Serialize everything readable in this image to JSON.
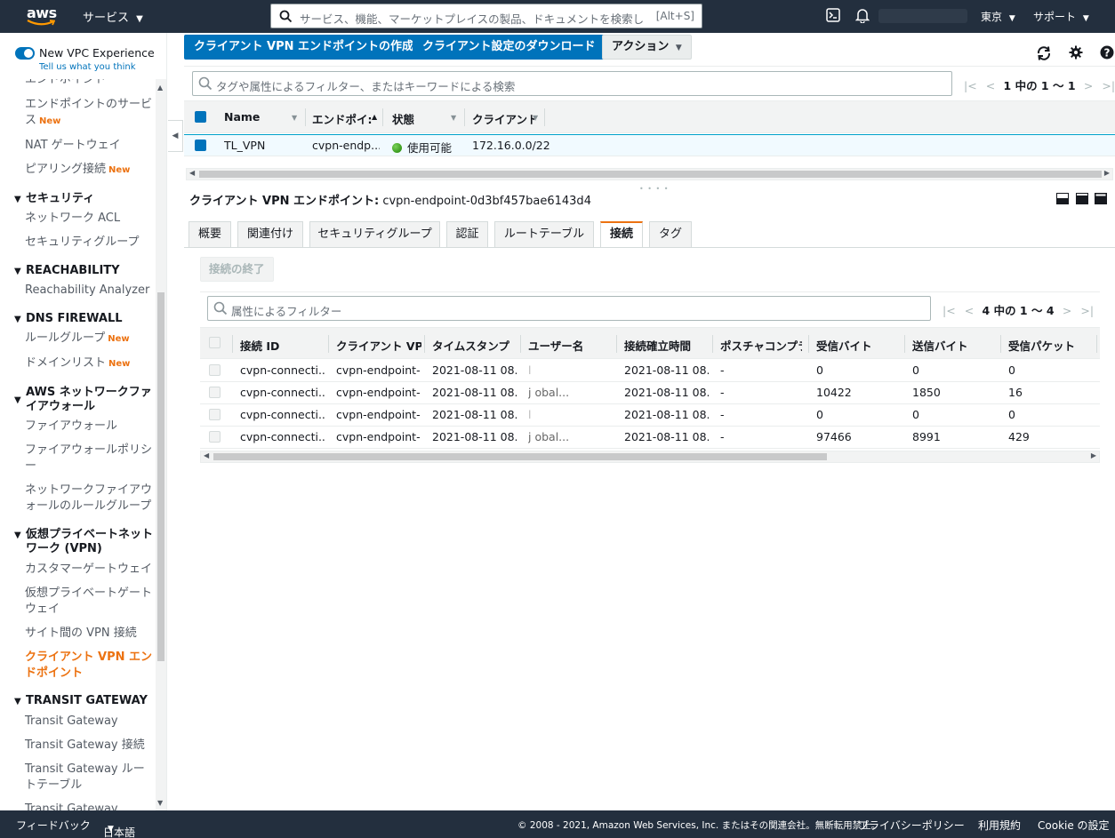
{
  "topnav": {
    "logo": "aws",
    "services_label": "サービス",
    "search_placeholder": "サービス、機能、マーケットプレイスの製品、ドキュメントを検索し",
    "search_shortcut": "[Alt+S]",
    "region_label": "東京",
    "support_label": "サポート"
  },
  "sidebar": {
    "vpc_experience_label": "New VPC Experience",
    "feedback_link": "Tell us what you think",
    "new_badge": "New",
    "items": {
      "endpoints": "エンドポイント",
      "endpoint_services": "エンドポイントのサービス",
      "nat_gateway": "NAT ゲートウェイ",
      "peering": "ピアリング接続",
      "network_acl": "ネットワーク ACL",
      "security_groups": "セキュリティグループ",
      "reachability_analyzer": "Reachability Analyzer",
      "rule_groups": "ルールグループ",
      "domain_lists": "ドメインリスト",
      "firewalls": "ファイアウォール",
      "firewall_policies": "ファイアウォールポリシー",
      "network_firewall_rule_groups": "ネットワークファイアウォールのルールグループ",
      "customer_gateways": "カスタマーゲートウェイ",
      "virtual_private_gateways": "仮想プライベートゲートウェイ",
      "site_to_site_vpn": "サイト間の VPN 接続",
      "client_vpn_endpoints": "クライアント VPN エンドポイント",
      "transit_gateways": "Transit Gateway",
      "transit_gateway_attachments": "Transit Gateway 接続",
      "transit_gateway_route_tables": "Transit Gateway ルートテーブル",
      "transit_gateway_more": "Transit Gateway"
    },
    "sections": {
      "security": "セキュリティ",
      "reachability": "REACHABILITY",
      "dns_firewall": "DNS FIREWALL",
      "network_firewall": "AWS ネットワークファイアウォール",
      "vpn": "仮想プライベートネットワーク (VPN)",
      "transit_gateway": "TRANSIT GATEWAY"
    }
  },
  "toolbar": {
    "create_button": "クライアント VPN エンドポイントの作成",
    "download_button": "クライアント設定のダウンロード",
    "actions_button": "アクション"
  },
  "endpoints_table": {
    "filter_placeholder": "タグや属性によるフィルター、またはキーワードによる検索",
    "pager_text": "1 中の 1 ～ 1",
    "columns": [
      "Name",
      "エンドポイ:",
      "状態",
      "クライアント"
    ],
    "rows": [
      {
        "name": "TL_VPN",
        "endpoint": "cvpn-endp...",
        "status": "使用可能",
        "client_cidr": "172.16.0.0/22"
      }
    ]
  },
  "detail": {
    "title_label": "クライアント VPN エンドポイント:",
    "endpoint_id": "cvpn-endpoint-0d3bf457bae6143d4",
    "tabs": [
      "概要",
      "関連付け",
      "セキュリティグループ",
      "認証",
      "ルートテーブル",
      "接続",
      "タグ"
    ],
    "active_tab": "接続",
    "terminate_button": "接続の終了"
  },
  "connections_table": {
    "filter_placeholder": "属性によるフィルター",
    "pager_text": "4 中の 1 ～ 4",
    "columns": [
      "接続 ID",
      "クライアント VP",
      "タイムスタンプ",
      "ユーザー名",
      "接続確立時間",
      "ポスチャコンプラ",
      "受信バイト",
      "送信バイト",
      "受信パケット"
    ],
    "rows": [
      {
        "id": "cvpn-connecti...",
        "endpoint": "cvpn-endpoint-...",
        "timestamp": "2021-08-11 08...",
        "username": "l",
        "established": "2021-08-11 08...",
        "posture": "-",
        "ingress_bytes": "0",
        "egress_bytes": "0",
        "ingress_packets": "0"
      },
      {
        "id": "cvpn-connecti...",
        "endpoint": "cvpn-endpoint-...",
        "timestamp": "2021-08-11 08...",
        "username": "j          obal...",
        "established": "2021-08-11 08...",
        "posture": "-",
        "ingress_bytes": "10422",
        "egress_bytes": "1850",
        "ingress_packets": "16"
      },
      {
        "id": "cvpn-connecti...",
        "endpoint": "cvpn-endpoint-...",
        "timestamp": "2021-08-11 08...",
        "username": "l",
        "established": "2021-08-11 08...",
        "posture": "-",
        "ingress_bytes": "0",
        "egress_bytes": "0",
        "ingress_packets": "0"
      },
      {
        "id": "cvpn-connecti...",
        "endpoint": "cvpn-endpoint-...",
        "timestamp": "2021-08-11 08...",
        "username": "j          obal...",
        "established": "2021-08-11 08...",
        "posture": "-",
        "ingress_bytes": "97466",
        "egress_bytes": "8991",
        "ingress_packets": "429"
      }
    ]
  },
  "footer": {
    "feedback": "フィードバック",
    "language": "日本語",
    "copyright": "© 2008 - 2021, Amazon Web Services, Inc. またはその関連会社。無断転用禁止。",
    "privacy": "プライバシーポリシー",
    "terms": "利用規約",
    "cookie": "Cookie の設定"
  },
  "colors": {
    "nav_bg": "#232f3e",
    "primary": "#0073bb",
    "accent": "#ec7211",
    "status_ok": "#1d8102"
  }
}
